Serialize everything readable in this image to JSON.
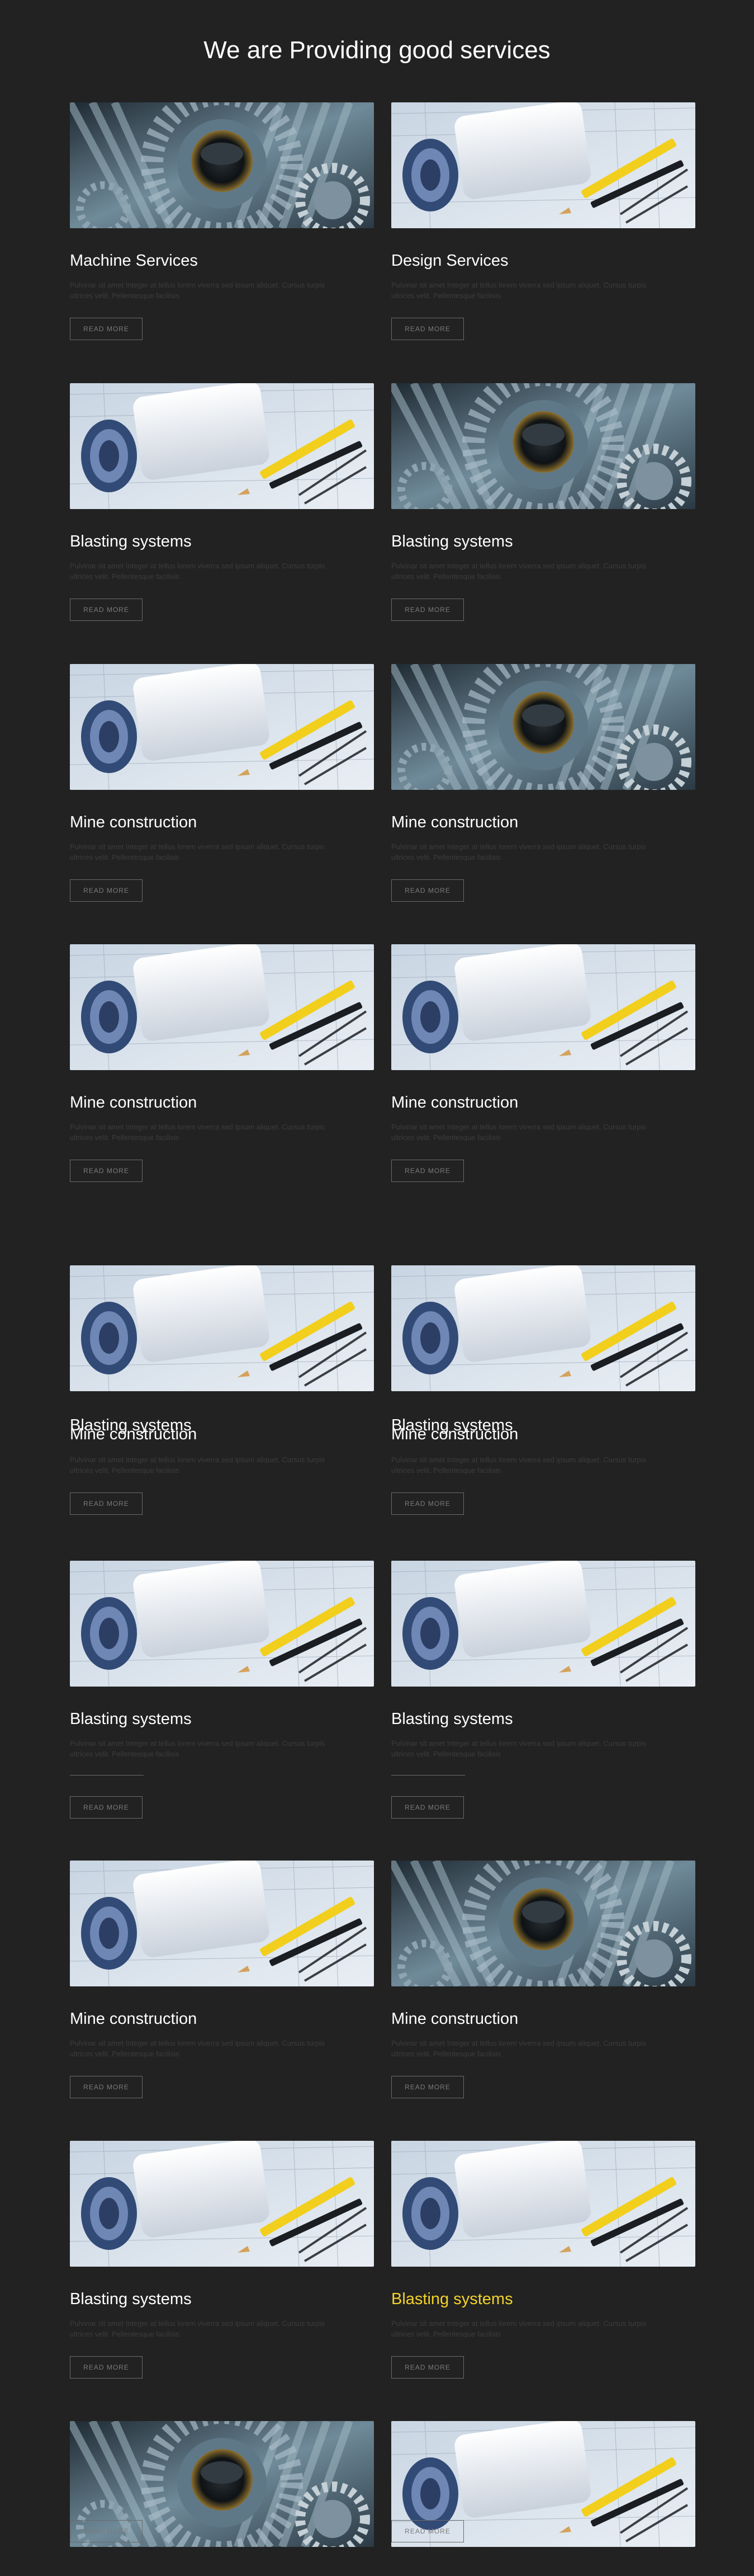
{
  "heading": "We are Providing good services",
  "button_label": "READ MORE",
  "body_text": "Pulvinar sit amet Integer at tellus lorem viverra sed ipsum aliquet. Cursus turpis ultrices velit. Pellentesque facilisis",
  "colors": {
    "background": "#222222",
    "title": "#ffffff",
    "highlight": "#f2d22b",
    "button_border": "#6b6b6b"
  },
  "cards": [
    {
      "title": "Machine Services",
      "image": "gears"
    },
    {
      "title": "Design Services",
      "image": "blueprints"
    },
    {
      "title": "Blasting systems",
      "image": "blueprints"
    },
    {
      "title": "Blasting systems",
      "image": "gears"
    },
    {
      "title": "Mine construction",
      "image": "blueprints"
    },
    {
      "title": "Mine construction",
      "image": "gears"
    },
    {
      "title": "Mine construction",
      "image": "blueprints"
    },
    {
      "title": "Mine construction",
      "image": "blueprints"
    },
    {
      "title": "Blasting systems",
      "title_overlay": "Mine construction",
      "image": "blueprints"
    },
    {
      "title": "Blasting systems",
      "title_overlay": "Mine construction",
      "image": "blueprints"
    },
    {
      "title": "Blasting systems",
      "image": "blueprints"
    },
    {
      "title": "Blasting systems",
      "image": "blueprints"
    },
    {
      "title": "Mine construction",
      "image": "blueprints"
    },
    {
      "title": "Mine construction",
      "image": "gears"
    },
    {
      "title": "Blasting systems",
      "image": "blueprints"
    },
    {
      "title": "Blasting systems",
      "image": "blueprints"
    },
    {
      "title": "",
      "image": "gears"
    },
    {
      "title": "",
      "image": "blueprints"
    }
  ]
}
